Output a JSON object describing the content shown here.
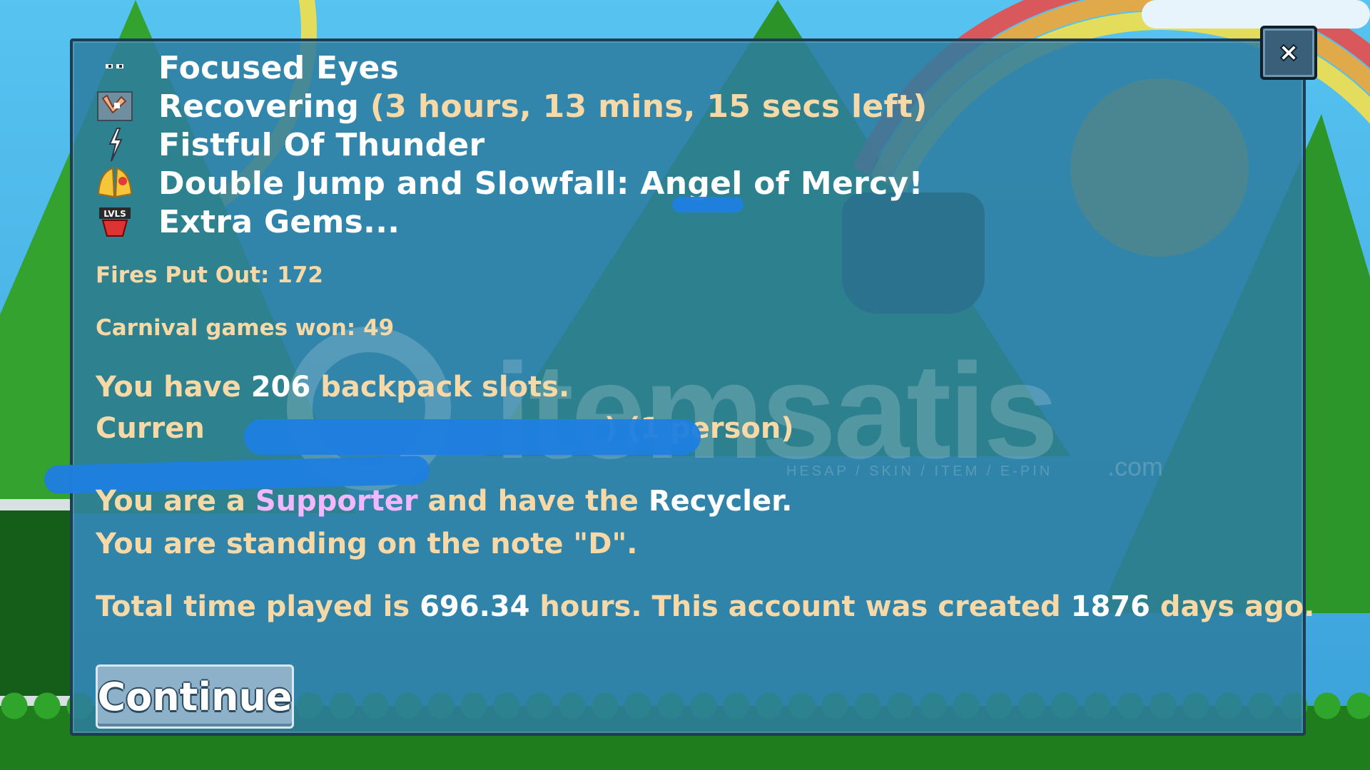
{
  "dialog": {
    "buffs": [
      {
        "icon": "eyes-icon",
        "label": "Focused Eyes"
      },
      {
        "icon": "bandage-arm-icon",
        "label": "Recovering",
        "timer": "(3 hours, 13 mins, 15 secs",
        "timer_end": "left)"
      },
      {
        "icon": "lightning-icon",
        "label": "Fistful Of Thunder"
      },
      {
        "icon": "angel-wings-icon",
        "label": "Double Jump and Slowfall: Angel of Mercy!"
      },
      {
        "icon": "lvl-badge-icon",
        "label": "Extra Gems...",
        "badge_text": "LVLS"
      }
    ],
    "fires_put_out": "Fires Put Out: 172",
    "carnival_games": "Carnival games won: 49",
    "backpack": {
      "prefix": "You have ",
      "count": "206",
      "suffix": " backpack slots."
    },
    "current_world": {
      "visible_start": "Curren",
      "visible_end": ") (1 person)"
    },
    "supporter": {
      "prefix": "You are a ",
      "status": "Supporter",
      "middle": " and have the ",
      "item": "Recycler",
      "suffix": "."
    },
    "note": "You are standing on the note \"D\".",
    "playtime": {
      "prefix": "Total time played is ",
      "hours": "696.34",
      "middle": " hours.  This account was created ",
      "days": "1876",
      "suffix": " days ago."
    },
    "continue_label": "Continue",
    "close_icon": "close-icon"
  },
  "watermark": {
    "brand": "itemsatis",
    "tagline": "HESAP / SKIN / ITEM / E-PIN",
    "domain": ".com"
  },
  "colors": {
    "panel": "#2d7da0",
    "highlight_text": "#f6d9a6",
    "supporter": "#f3b7ff",
    "redaction": "#1f7fe0"
  }
}
